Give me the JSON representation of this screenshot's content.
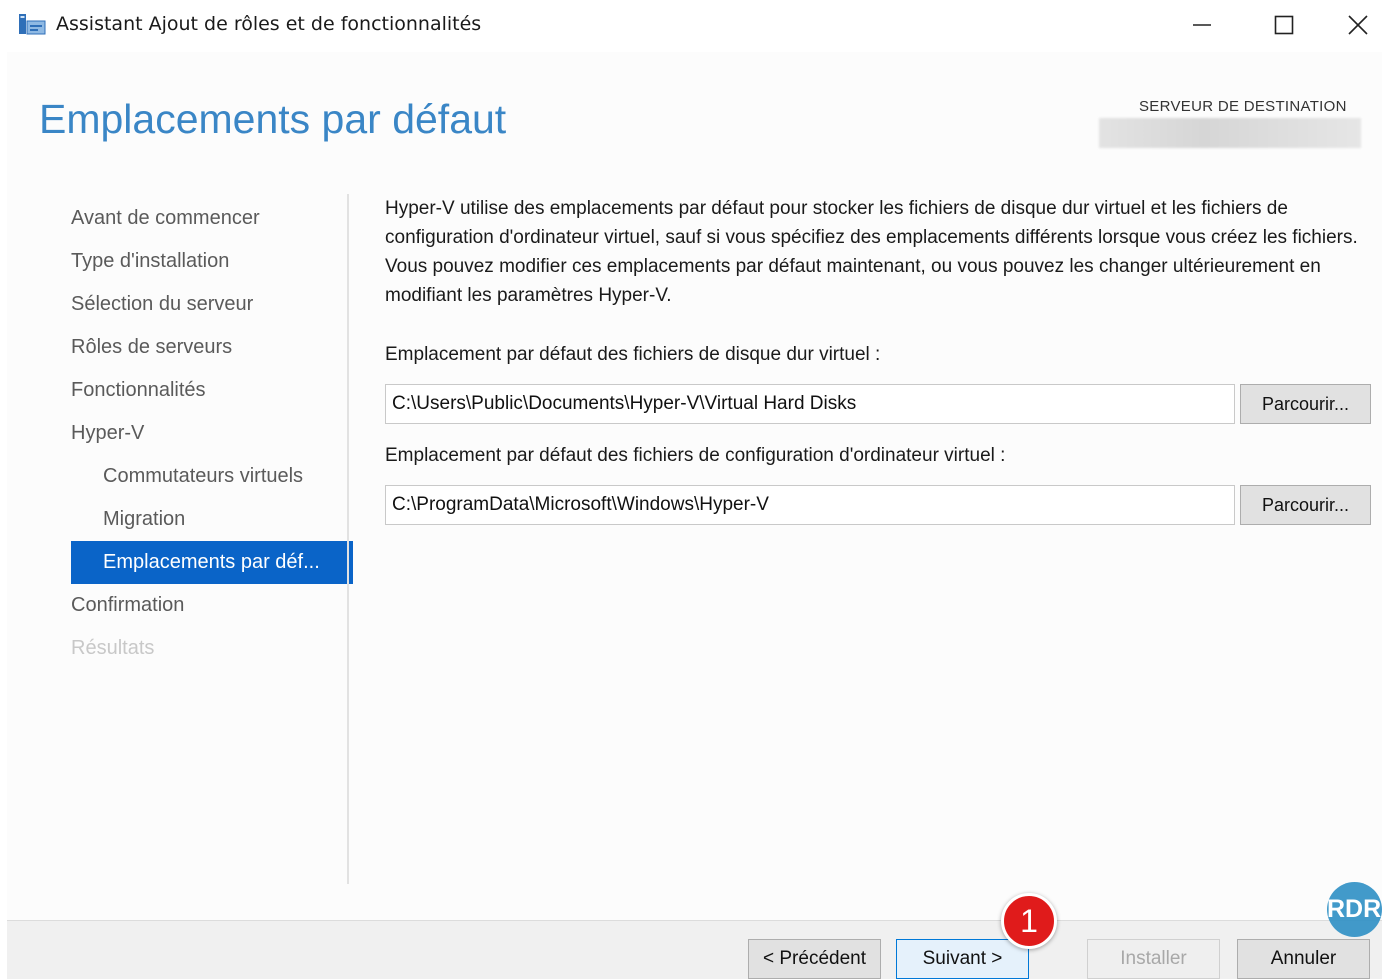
{
  "window": {
    "title": "Assistant Ajout de rôles et de fonctionnalités",
    "icon": "server-manager-icon",
    "controls": [
      "minimize-icon",
      "maximize-icon",
      "close-icon"
    ]
  },
  "header": {
    "page_title": "Emplacements par défaut",
    "destination_label": "SERVEUR DE DESTINATION",
    "destination_value": ""
  },
  "nav": {
    "items": [
      {
        "label": "Avant de commencer",
        "level": 0,
        "state": "normal"
      },
      {
        "label": "Type d'installation",
        "level": 0,
        "state": "normal"
      },
      {
        "label": "Sélection du serveur",
        "level": 0,
        "state": "normal"
      },
      {
        "label": "Rôles de serveurs",
        "level": 0,
        "state": "normal"
      },
      {
        "label": "Fonctionnalités",
        "level": 0,
        "state": "normal"
      },
      {
        "label": "Hyper-V",
        "level": 0,
        "state": "normal"
      },
      {
        "label": "Commutateurs virtuels",
        "level": 1,
        "state": "normal"
      },
      {
        "label": "Migration",
        "level": 1,
        "state": "normal"
      },
      {
        "label": "Emplacements par déf...",
        "level": 1,
        "state": "active"
      },
      {
        "label": "Confirmation",
        "level": 0,
        "state": "normal"
      },
      {
        "label": "Résultats",
        "level": 0,
        "state": "disabled"
      }
    ]
  },
  "main": {
    "description": "Hyper-V utilise des emplacements par défaut pour stocker les fichiers de disque dur virtuel et les fichiers de configuration d'ordinateur virtuel, sauf si vous spécifiez des emplacements différents lorsque vous créez les fichiers. Vous pouvez modifier ces emplacements par défaut maintenant, ou vous pouvez les changer ultérieurement en modifiant les paramètres Hyper-V.",
    "vhd_label": "Emplacement par défaut des fichiers de disque dur virtuel :",
    "vhd_path": "C:\\Users\\Public\\Documents\\Hyper-V\\Virtual Hard Disks",
    "config_label": "Emplacement par défaut des fichiers de configuration d'ordinateur virtuel :",
    "config_path": "C:\\ProgramData\\Microsoft\\Windows\\Hyper-V",
    "browse_label": "Parcourir..."
  },
  "footer": {
    "prev_label": "< Précédent",
    "next_label": "Suivant >",
    "install_label": "Installer",
    "cancel_label": "Annuler"
  },
  "annotation": {
    "step_number": "1"
  },
  "watermark": {
    "text": "RDR"
  },
  "colors": {
    "accent": "#0a64c8",
    "title_blue": "#3a86c6",
    "badge_red": "#e01b1b",
    "watermark_blue": "#2e8fc4"
  }
}
